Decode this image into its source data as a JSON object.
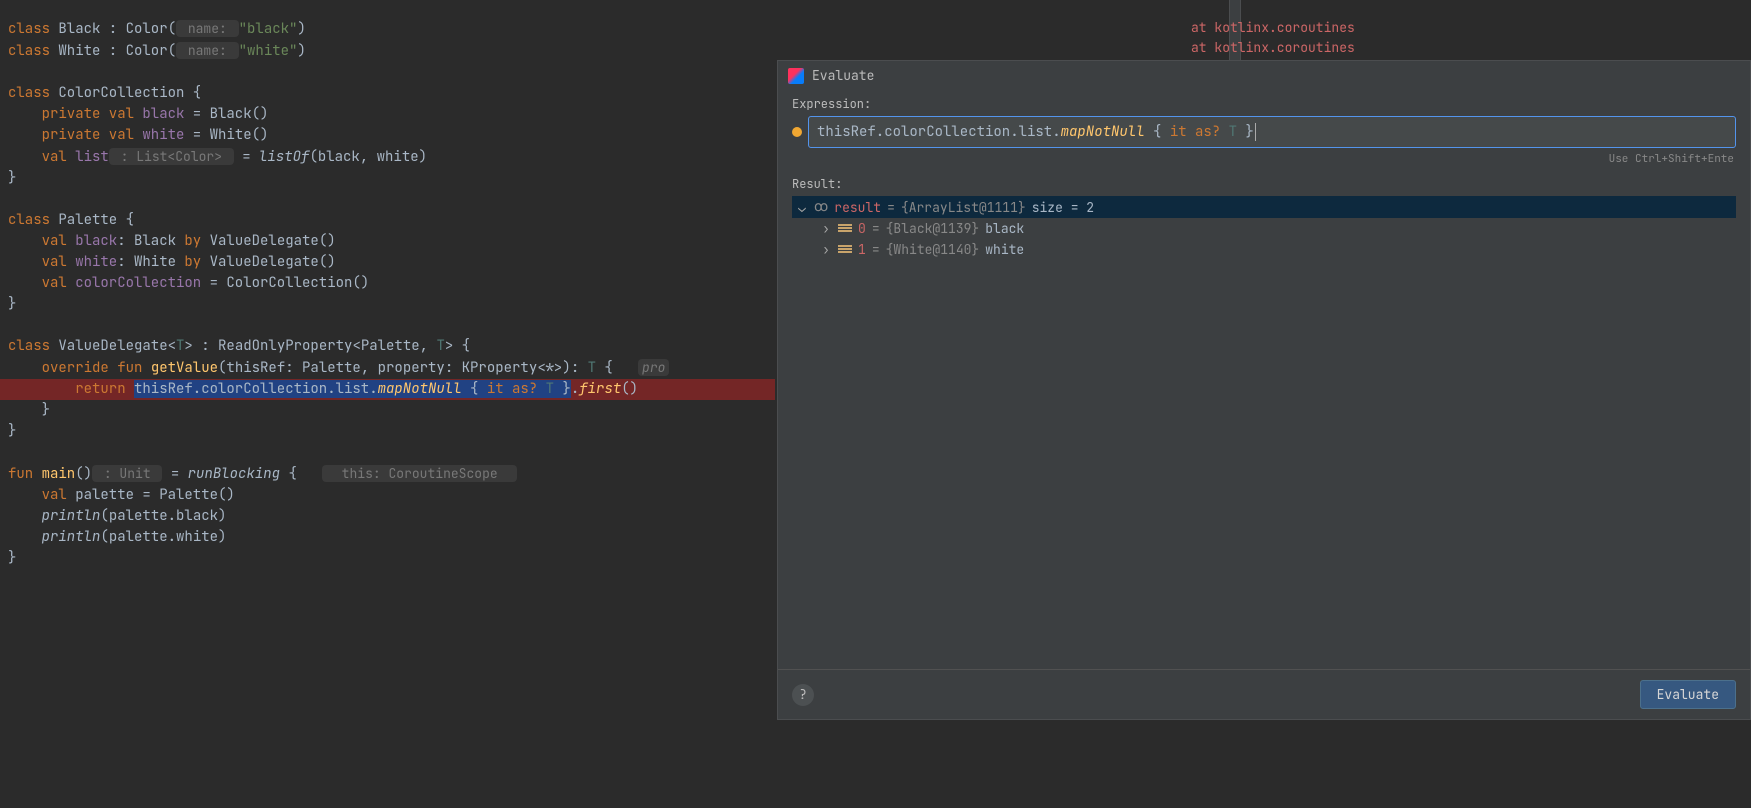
{
  "editor": {
    "l1_class": "class ",
    "l1_name": "Black : Color(",
    "l1_hint": " name: ",
    "l1_str": "\"black\"",
    "l1_end": ")",
    "l2_class": "class ",
    "l2_name": "White : Color(",
    "l2_hint": " name: ",
    "l2_str": "\"white\"",
    "l2_end": ")",
    "l4": "class ",
    "l4b": "ColorCollection {",
    "l5a": "    private val ",
    "l5b": "black",
    "l5c": " = Black()",
    "l6a": "    private val ",
    "l6b": "white",
    "l6c": " = White()",
    "l7a": "    val ",
    "l7b": "list",
    "l7hint": " : List<Color> ",
    "l7c": " = ",
    "l7d": "listOf",
    "l7e": "(black, white)",
    "l8": "}",
    "l10a": "class ",
    "l10b": "Palette {",
    "l11a": "    val ",
    "l11b": "black",
    "l11c": ": Black ",
    "l11d": "by",
    "l11e": " ValueDelegate()",
    "l12a": "    val ",
    "l12b": "white",
    "l12c": ": White ",
    "l12d": "by",
    "l12e": " ValueDelegate()",
    "l13a": "    val ",
    "l13b": "colorCollection",
    "l13c": " = ColorCollection()",
    "l14": "}",
    "l16a": "class ",
    "l16b": "ValueDelegate",
    "l16c": "<",
    "l16d": "T",
    "l16e": "> : ",
    "l16f": "ReadOnlyProperty",
    "l16g": "<Palette, ",
    "l16h": "T",
    "l16i": "> {",
    "l17a": "    override fun ",
    "l17b": "getValue",
    "l17c": "(thisRef: Palette, property: KProperty<*>): ",
    "l17d": "T",
    "l17e": " {   ",
    "l17hint": "pro",
    "l18a": "        return ",
    "l18sel": "thisRef.colorCollection.list.",
    "l18sel2": "mapNotNull",
    "l18sel3": " { ",
    "l18sel4": "it ",
    "l18sel5": "as? ",
    "l18sel6": "T",
    "l18sel7": " }",
    "l18b": ".",
    "l18c": "first",
    "l18d": "()",
    "l19": "    }",
    "l20": "}",
    "l22a": "fun ",
    "l22b": "main",
    "l22c": "()",
    "l22hint": " : Unit ",
    "l22d": " = ",
    "l22e": "runBlocking",
    "l22f": " {",
    "l22hint2": "  this: CoroutineScope  ",
    "l23a": "    val ",
    "l23b": "palette = Palette()",
    "l24a": "    ",
    "l24b": "println",
    "l24c": "(palette.black)",
    "l25a": "    ",
    "l25b": "println",
    "l25c": "(palette.white)",
    "l26": "}"
  },
  "console": {
    "line1a": "at ",
    "line1b": "kotlinx.coroutines",
    "line2a": "at ",
    "line2b": "kotlinx.coroutines"
  },
  "dialog": {
    "title": "Evaluate",
    "expr_label": "Expression:",
    "expr_p1": "thisRef.colorCollection.list.",
    "expr_p2": "mapNotNull",
    "expr_p3": " { ",
    "expr_p4": "it ",
    "expr_p5": "as?",
    "expr_p6": " T ",
    "expr_p7": "}",
    "hint": "Use Ctrl+Shift+Ente",
    "result_label": "Result:",
    "root_name": "result",
    "root_eq": " = ",
    "root_obj": "{ArrayList@1111}",
    "root_size": "  size = 2",
    "item0_idx": "0",
    "item0_eq": " = ",
    "item0_obj": "{Black@1139}",
    "item0_val": " black",
    "item1_idx": "1",
    "item1_eq": " = ",
    "item1_obj": "{White@1140}",
    "item1_val": " white",
    "evaluate_btn": "Evaluate"
  }
}
